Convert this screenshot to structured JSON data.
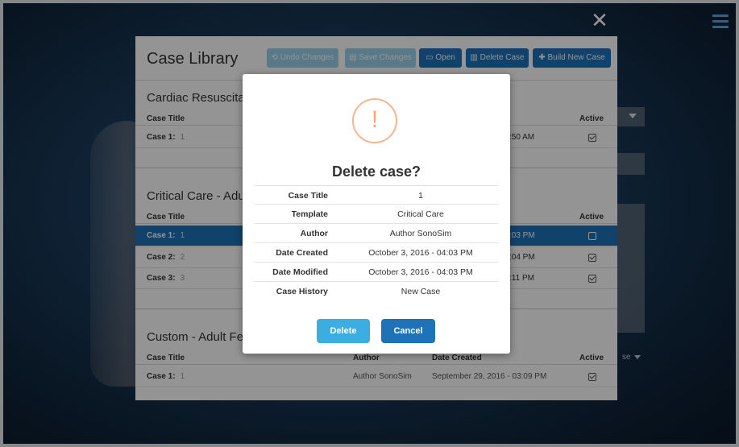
{
  "toolbar": {
    "close_symbol": "✕",
    "undo": "Undo Changes",
    "save": "Save Changes",
    "open": "Open",
    "delete": "Delete Case",
    "build": "Build New Case"
  },
  "library": {
    "title": "Case Library",
    "sections": [
      {
        "title": "Cardiac Resuscitat",
        "headers": {
          "case_title": "Case Title",
          "active": "Active"
        },
        "rows": [
          {
            "label": "Case 1:",
            "num": "1",
            "time": ":50 AM",
            "active": true,
            "selected": false
          }
        ]
      },
      {
        "title": "Critical Care - Adu",
        "headers": {
          "case_title": "Case Title",
          "active": "Active"
        },
        "rows": [
          {
            "label": "Case 1:",
            "num": "1",
            "time": ":03 PM",
            "active": false,
            "selected": true
          },
          {
            "label": "Case 2:",
            "num": "2",
            "time": ":04 PM",
            "active": true,
            "selected": false
          },
          {
            "label": "Case 3:",
            "num": "3",
            "time": ":11 PM",
            "active": true,
            "selected": false
          }
        ]
      },
      {
        "title": "Custom - Adult Fe",
        "headers": {
          "case_title": "Case Title",
          "author": "Author",
          "date_created": "Date Created",
          "active": "Active"
        },
        "rows": [
          {
            "label": "Case 1:",
            "num": "1",
            "author": "Author SonoSim",
            "date": "September 29, 2016 - 03:09 PM",
            "active": true,
            "selected": false
          }
        ]
      }
    ],
    "side_label": "se"
  },
  "modal": {
    "icon": "!",
    "title": "Delete case?",
    "rows": [
      {
        "label": "Case Title",
        "value": "1"
      },
      {
        "label": "Template",
        "value": "Critical Care"
      },
      {
        "label": "Author",
        "value": "Author SonoSim"
      },
      {
        "label": "Date Created",
        "value": "October 3, 2016 - 04:03 PM"
      },
      {
        "label": "Date Modified",
        "value": "October 3, 2016 - 04:03 PM"
      },
      {
        "label": "Case History",
        "value": "New Case"
      }
    ],
    "delete_label": "Delete",
    "cancel_label": "Cancel"
  },
  "colors": {
    "primary": "#1e72b8",
    "disabled": "#9bd0ea",
    "modal_delete": "#3aaee0",
    "modal_cancel": "#1e72b8",
    "warning": "#f5a77a"
  },
  "icons": {
    "undo": "undo-icon",
    "save": "save-icon",
    "open": "folder-open-icon",
    "delete": "trash-icon",
    "build": "build-icon",
    "close": "close-icon",
    "menu": "hamburger-icon",
    "warning": "warning-icon"
  }
}
